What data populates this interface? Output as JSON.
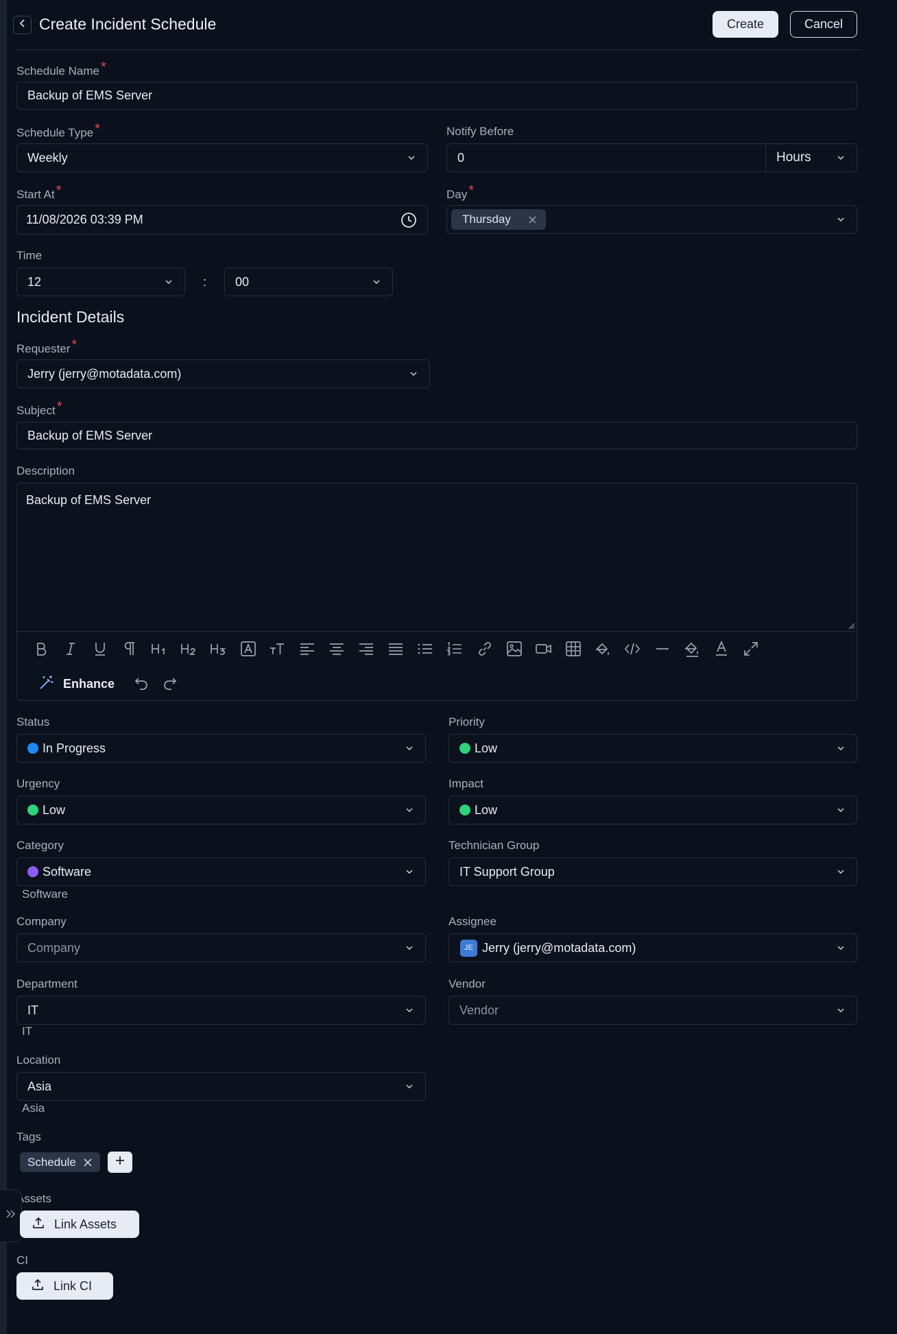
{
  "header": {
    "title": "Create Incident Schedule",
    "create_label": "Create",
    "cancel_label": "Cancel"
  },
  "schedule": {
    "name_label": "Schedule Name",
    "name_value": "Backup of EMS Server",
    "type_label": "Schedule Type",
    "type_value": "Weekly",
    "notify_label": "Notify Before",
    "notify_value": "0",
    "notify_unit": "Hours",
    "start_label": "Start At",
    "start_value": "11/08/2026 03:39 PM",
    "day_label": "Day",
    "day_tag": "Thursday",
    "time_label": "Time",
    "time_hour": "12",
    "time_sep": ":",
    "time_minute": "00"
  },
  "incident": {
    "section_title": "Incident Details",
    "requester_label": "Requester",
    "requester_value": "Jerry (jerry@motadata.com)",
    "subject_label": "Subject",
    "subject_value": "Backup of EMS Server",
    "description_label": "Description",
    "description_value": "Backup of EMS Server",
    "enhance_label": "Enhance"
  },
  "fields": {
    "status_label": "Status",
    "status_value": "In Progress",
    "priority_label": "Priority",
    "priority_value": "Low",
    "urgency_label": "Urgency",
    "urgency_value": "Low",
    "impact_label": "Impact",
    "impact_value": "Low",
    "category_label": "Category",
    "category_value": "Software",
    "category_path": "Software",
    "techgroup_label": "Technician Group",
    "techgroup_value": "IT Support Group",
    "company_label": "Company",
    "company_placeholder": "Company",
    "assignee_label": "Assignee",
    "assignee_value": "Jerry (jerry@motadata.com)",
    "assignee_initials": "JE",
    "department_label": "Department",
    "department_value": "IT",
    "department_path": "IT",
    "vendor_label": "Vendor",
    "vendor_placeholder": "Vendor",
    "location_label": "Location",
    "location_value": "Asia",
    "location_path": "Asia",
    "tags_label": "Tags",
    "tag_value": "Schedule",
    "assets_label": "Assets",
    "link_assets_label": "Link Assets",
    "ci_label": "CI",
    "link_ci_label": "Link CI"
  },
  "colors": {
    "status_in_progress": "#1e88f5",
    "low": "#2fd27a",
    "software": "#8b5cf6",
    "required": "#e5484d"
  },
  "icons": [
    "back-icon",
    "chevron-down-icon",
    "clock-icon",
    "close-icon",
    "bold-icon",
    "italic-icon",
    "underline-icon",
    "paragraph-icon",
    "h1-icon",
    "h2-icon",
    "h3-icon",
    "font-box-icon",
    "text-size-icon",
    "align-left-icon",
    "align-center-icon",
    "align-right-icon",
    "align-justify-icon",
    "bullet-list-icon",
    "numbered-list-icon",
    "link-icon",
    "image-icon",
    "video-icon",
    "table-icon",
    "fill-color-icon",
    "code-icon",
    "horizontal-rule-icon",
    "highlight-icon",
    "text-color-icon",
    "fullscreen-icon",
    "magic-wand-icon",
    "undo-icon",
    "redo-icon",
    "plus-icon",
    "upload-icon",
    "expand-sidebar-icon"
  ]
}
